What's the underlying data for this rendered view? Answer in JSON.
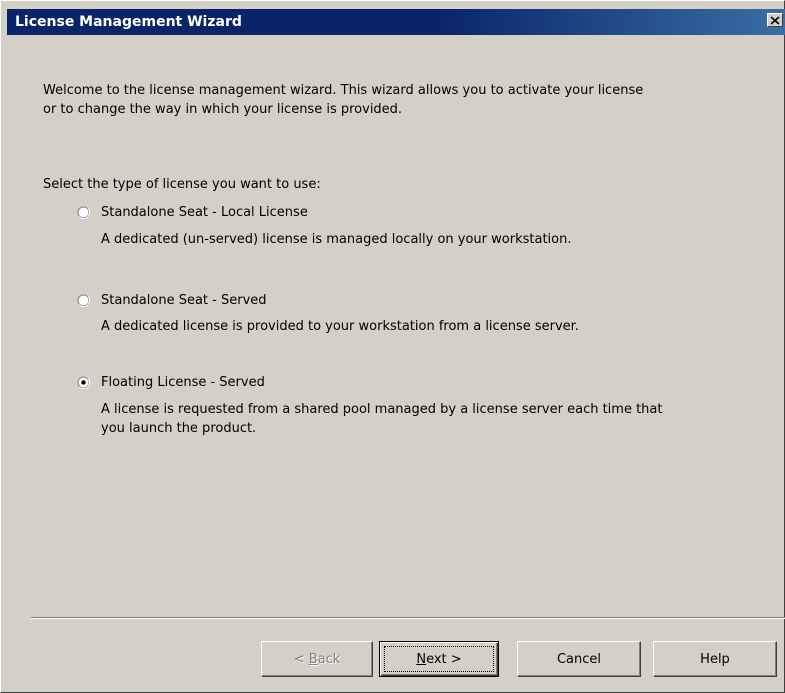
{
  "window": {
    "title": "License Management Wizard"
  },
  "intro": {
    "line1": "Welcome to the license management wizard. This wizard allows you to activate your license",
    "line2": "or to change the way in which your license is provided."
  },
  "prompt": "Select the type of license you want to use:",
  "options": [
    {
      "label": "Standalone Seat - Local License",
      "description": [
        "A dedicated (un-served) license is managed locally on your workstation."
      ],
      "selected": false
    },
    {
      "label": "Standalone Seat - Served",
      "description": [
        "A dedicated license is provided to your workstation from a license server."
      ],
      "selected": false
    },
    {
      "label": "Floating License - Served",
      "description": [
        "A license is requested from a shared pool managed by a license server each time that",
        "you launch the product."
      ],
      "selected": true
    }
  ],
  "buttons": {
    "back": {
      "prefix": "< ",
      "mnemonic": "B",
      "rest": "ack",
      "disabled": true
    },
    "next": {
      "mnemonic": "N",
      "rest": "ext >",
      "default": true
    },
    "cancel": "Cancel",
    "help": "Help"
  },
  "colors": {
    "face": "#d4d0c8",
    "title_bar": "#0a246a",
    "title_text": "#ffffff",
    "disabled_text": "#808080"
  },
  "icons": {
    "close": "close-icon"
  }
}
